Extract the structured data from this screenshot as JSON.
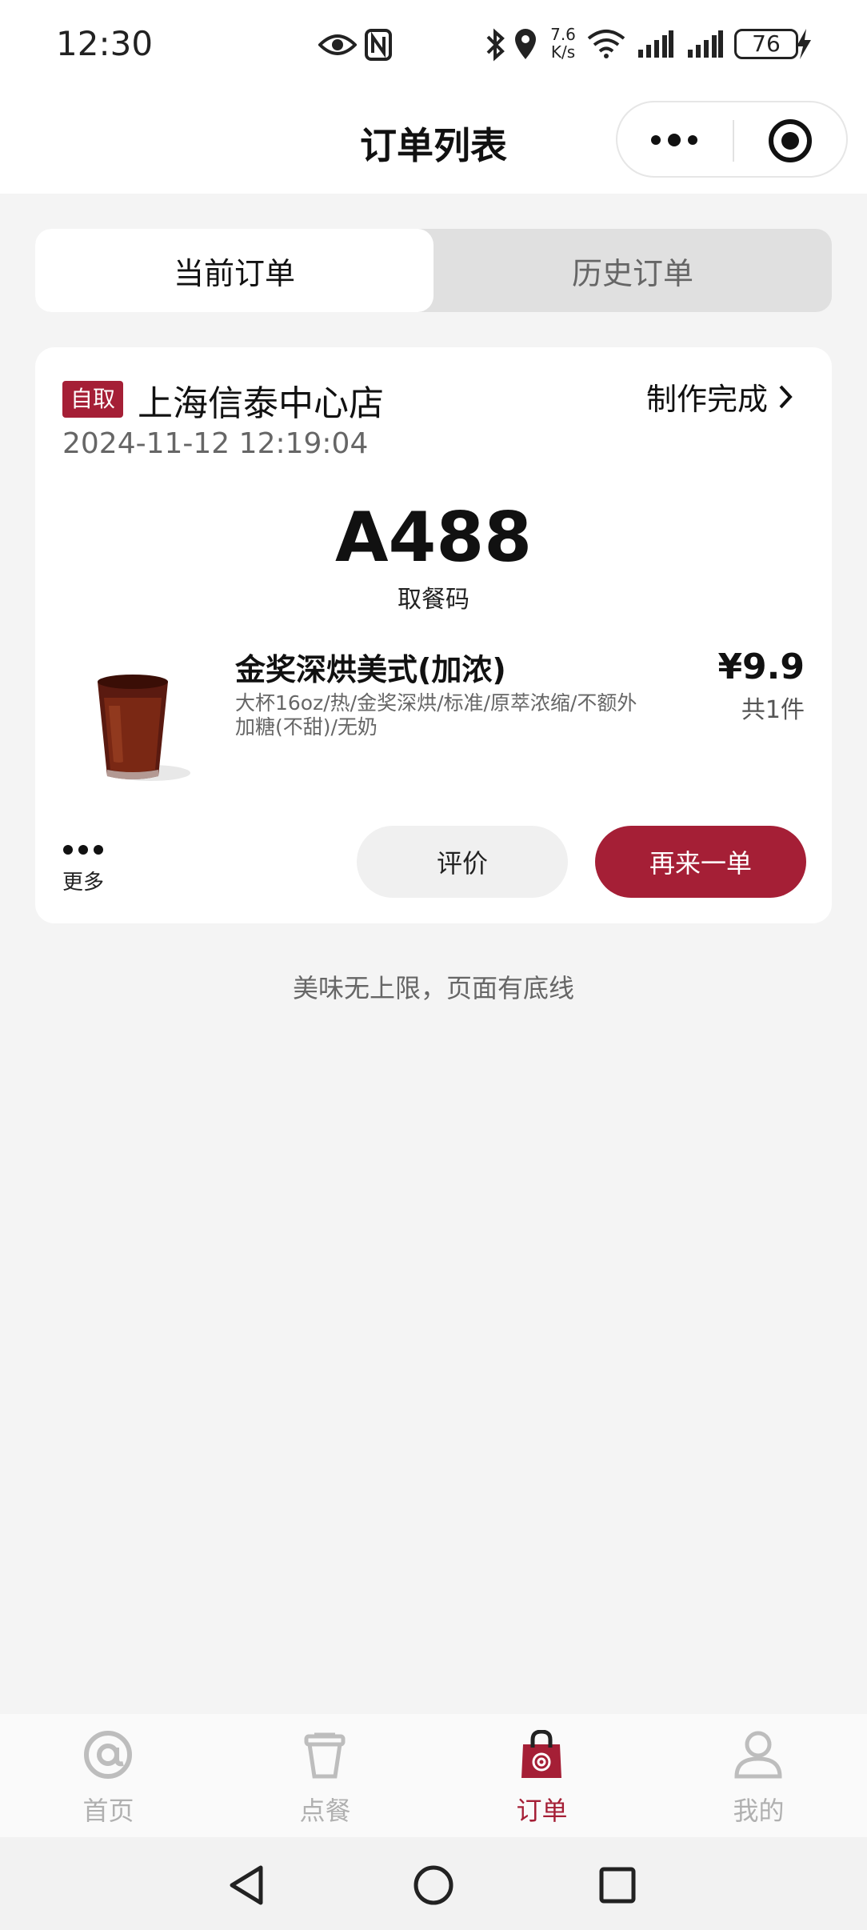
{
  "status_bar": {
    "time": "12:30",
    "net_speed_value": "7.6",
    "net_speed_unit": "K/s",
    "battery": "76",
    "icons": [
      "eye-icon",
      "nfc-icon",
      "bluetooth-icon",
      "location-icon",
      "wifi-icon",
      "signal-icon",
      "signal-icon",
      "battery-icon",
      "charging-icon"
    ]
  },
  "header": {
    "title": "订单列表",
    "icons": [
      "more-dots-icon",
      "target-icon"
    ]
  },
  "tabs": [
    {
      "label": "当前订单",
      "active": true
    },
    {
      "label": "历史订单",
      "active": false
    }
  ],
  "order": {
    "type_tag": "自取",
    "store_name": "上海信泰中心店",
    "status": "制作完成",
    "datetime": "2024-11-12 12:19:04",
    "pickup_code": "A488",
    "pickup_label": "取餐码",
    "item": {
      "name": "金奖深烘美式(加浓)",
      "spec": "大杯16oz/热/金奖深烘/标准/原萃浓缩/不额外加糖(不甜)/无奶",
      "price": "¥9.9",
      "quantity": "共1件",
      "image": "iced-americano-cup"
    },
    "more_label": "更多",
    "review_label": "评价",
    "reorder_label": "再来一单"
  },
  "footer_note": "美味无上限，页面有底线",
  "bottom_nav": [
    {
      "label": "首页",
      "icon": "at-sign-icon",
      "active": false
    },
    {
      "label": "点餐",
      "icon": "cup-icon",
      "active": false
    },
    {
      "label": "订单",
      "icon": "shopping-bag-icon",
      "active": true
    },
    {
      "label": "我的",
      "icon": "user-icon",
      "active": false
    }
  ],
  "colors": {
    "accent": "#a51f36",
    "background": "#f4f4f4",
    "inactive_nav": "#b0b0b0"
  }
}
